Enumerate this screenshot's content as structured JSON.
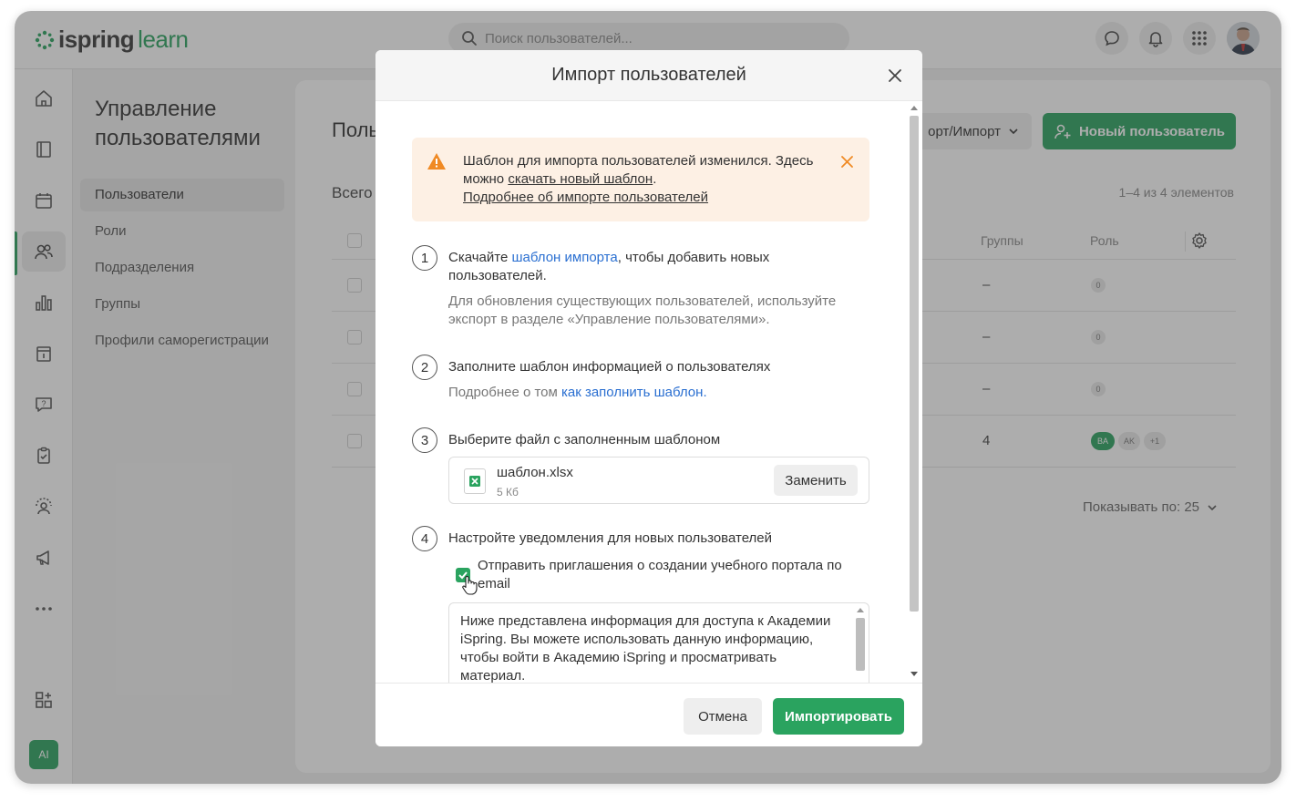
{
  "app": {
    "logo_word1": "ispring",
    "logo_word2": "learn",
    "search_placeholder": "Поиск пользователей...",
    "brand_color": "#2aa35f",
    "top_icons": [
      "chat-icon",
      "bell-icon",
      "apps-grid-icon",
      "user-avatar"
    ]
  },
  "sidebar": {
    "items": [
      "home-icon",
      "book-icon",
      "calendar-icon",
      "users-icon",
      "chart-icon",
      "info-card-icon",
      "question-icon",
      "clipboard-check-icon",
      "user-support-icon",
      "megaphone-icon",
      "more-icon",
      "add-widget-icon"
    ],
    "active": "users-icon",
    "ai_label": "AI"
  },
  "subnav": {
    "title": "Управление пользователями",
    "items": [
      "Пользователи",
      "Роли",
      "Подразделения",
      "Группы",
      "Профили саморегистрации"
    ]
  },
  "main": {
    "title": "Поль",
    "total": "Всего",
    "export_label": "орт/Импорт",
    "new_user_label": "Новый пользователь",
    "range": "1–4 из 4 элементов",
    "col_groups": "Группы",
    "col_role": "Роль",
    "rows": [
      {
        "groups": "–",
        "roles": [
          "0"
        ]
      },
      {
        "groups": "–",
        "roles": [
          "0"
        ]
      },
      {
        "groups": "–",
        "roles": [
          "0"
        ]
      },
      {
        "groups": "4",
        "roles": [
          "BA",
          "AK",
          "+1"
        ]
      }
    ],
    "page_size": "Показывать по: 25"
  },
  "modal": {
    "title": "Импорт пользователей",
    "alert": {
      "text1": "Шаблон для импорта пользователей изменился. Здесь можно ",
      "link1": "скачать новый шаблон",
      "text2": ".",
      "link2": "Подробнее об импорте пользователей"
    },
    "steps": [
      {
        "num": "1",
        "text_before": "Скачайте ",
        "link": "шаблон импорта",
        "text_after": ", чтобы добавить новых пользователей.",
        "sub": "Для обновления существующих пользователей, используйте экспорт в разделе «Управление пользователями»."
      },
      {
        "num": "2",
        "text": "Заполните шаблон информацией о пользователях",
        "sub_before": "Подробнее о том ",
        "sub_link": "как заполнить шаблон",
        "sub_after": "."
      },
      {
        "num": "3",
        "text": "Выберите файл с заполненным шаблоном"
      },
      {
        "num": "4",
        "text": "Настройте уведомления для новых пользователей"
      }
    ],
    "file": {
      "name": "шаблон.xlsx",
      "size": "5 Кб",
      "replace_label": "Заменить"
    },
    "checkbox_label": "Отправить приглашения о создании учебного портала по email",
    "checkbox_checked": true,
    "message_text": "Ниже представлена информация для доступа к Академии iSpring. Вы можете использовать данную информацию, чтобы войти в Академию iSpring и просматривать материал.",
    "cancel_label": "Отмена",
    "import_label": "Импортировать"
  }
}
